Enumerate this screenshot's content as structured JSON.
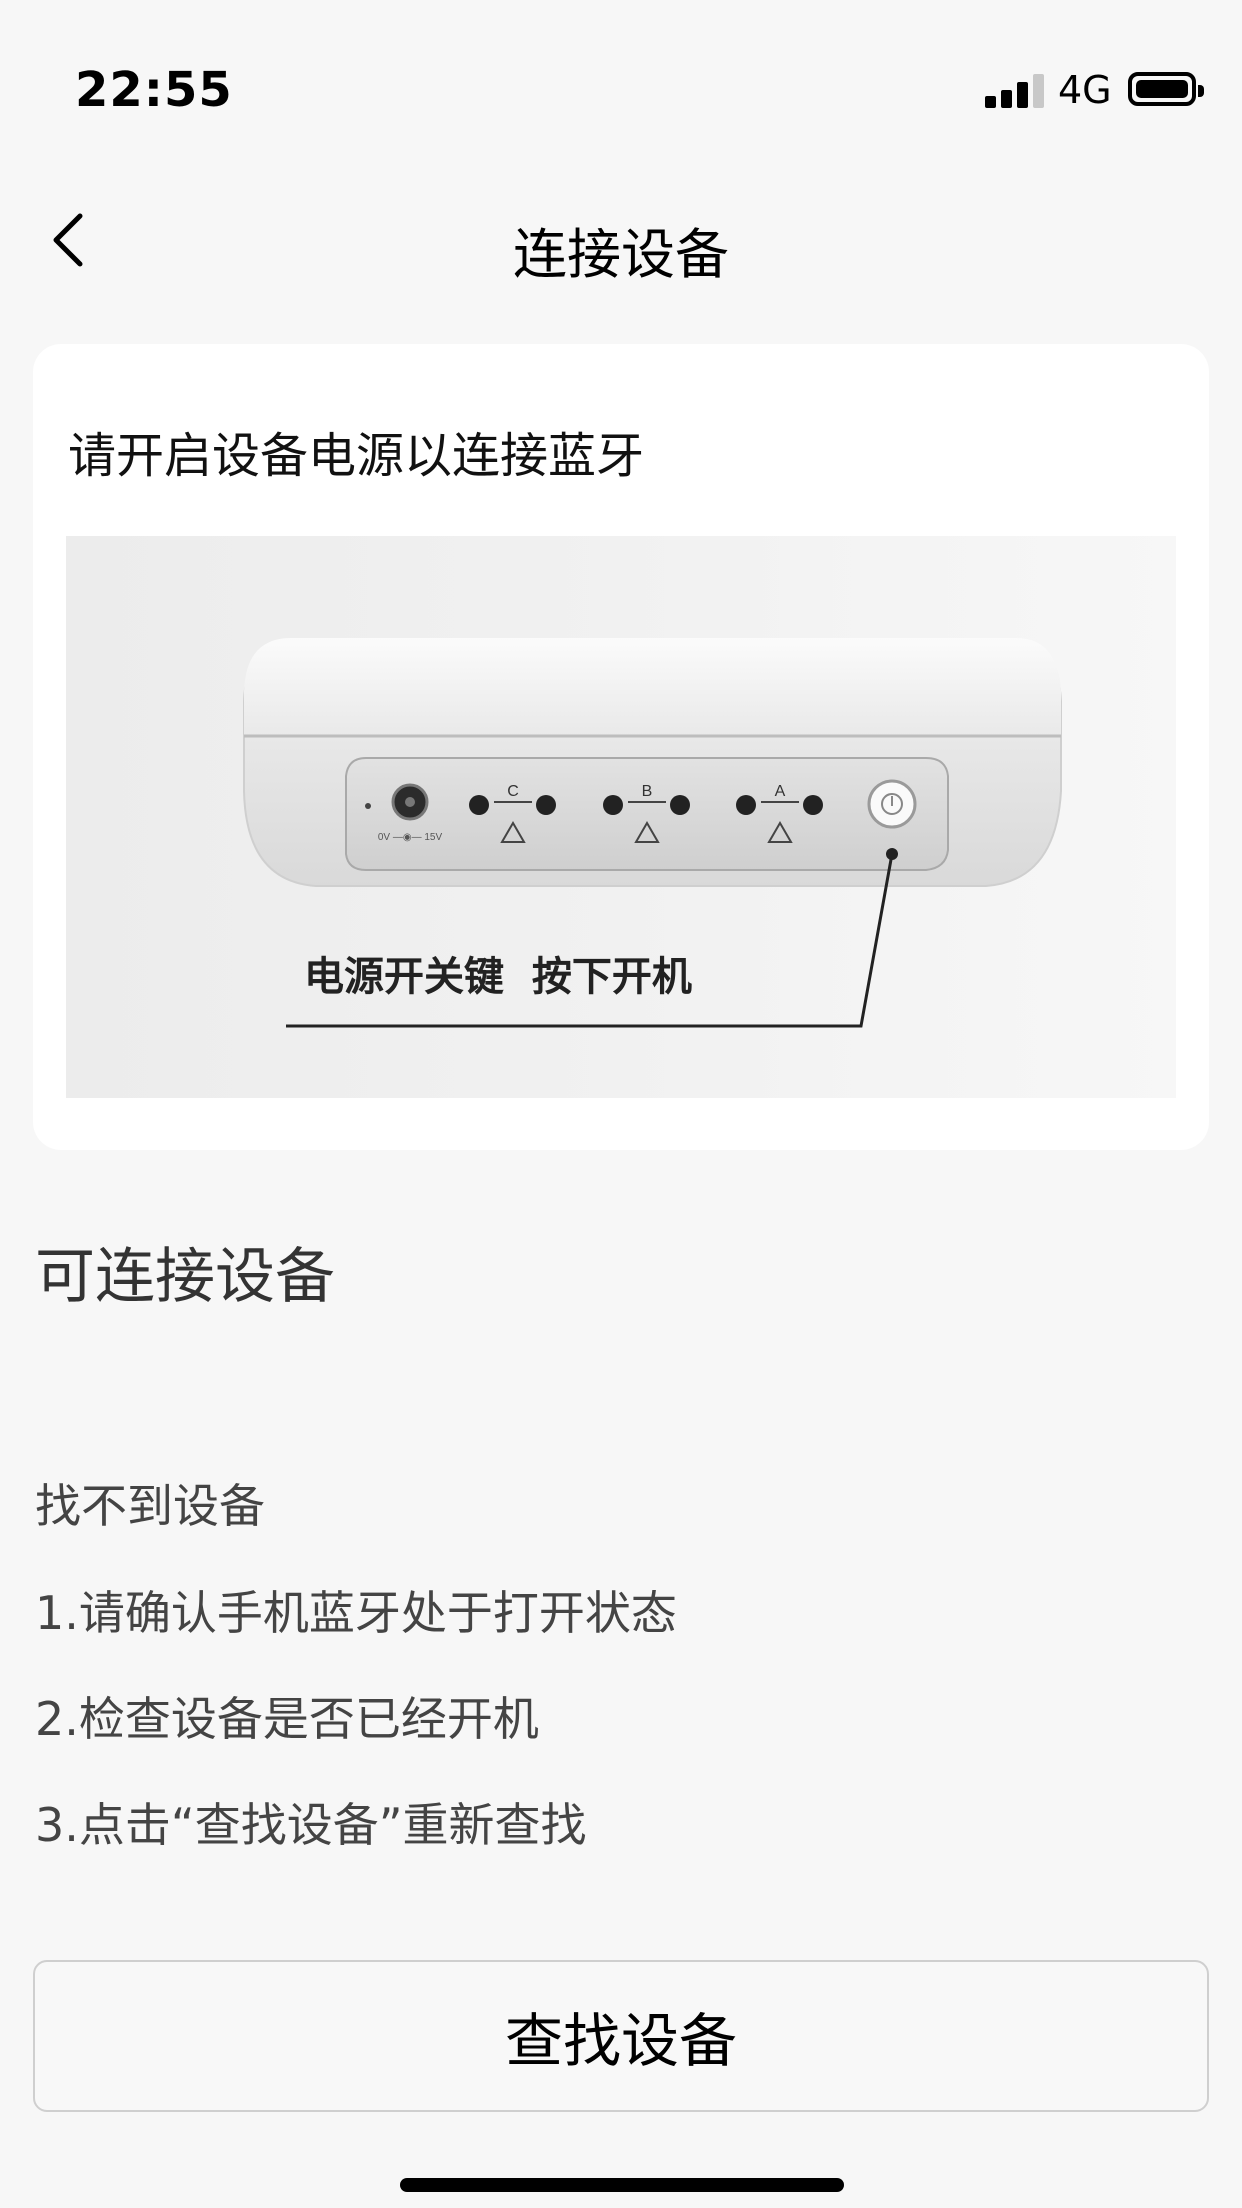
{
  "status_bar": {
    "time": "22:55",
    "network": "4G"
  },
  "nav": {
    "title": "连接设备",
    "back_icon": "chevron-left-icon"
  },
  "card": {
    "title": "请开启设备电源以连接蓝牙",
    "image": {
      "callout": "电源开关键  按下开机",
      "port_labels": [
        "C",
        "B",
        "A"
      ],
      "power_jack_label": "0V  15V"
    }
  },
  "section": {
    "title": "可连接设备"
  },
  "help": {
    "heading": "找不到设备",
    "steps": [
      "1.请确认手机蓝牙处于打开状态",
      "2.检查设备是否已经开机",
      "3.点击“查找设备”重新查找"
    ]
  },
  "find_button": {
    "label": "查找设备"
  }
}
